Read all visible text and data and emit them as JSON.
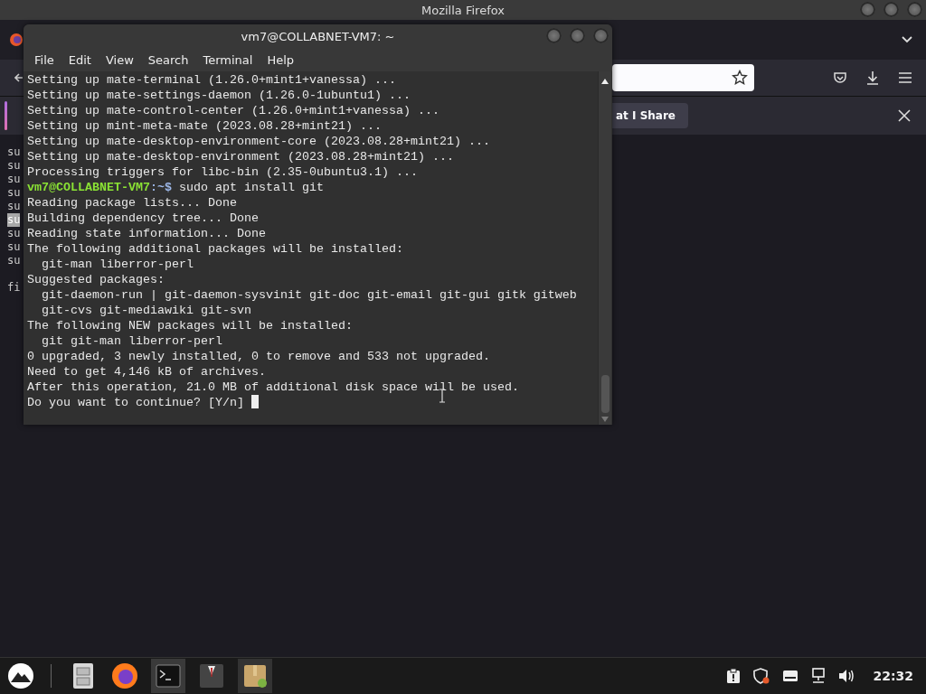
{
  "firefox": {
    "title": "Mozilla Firefox",
    "notification": "at I Share",
    "page_lines": [
      {
        "text": "su",
        "selected": false
      },
      {
        "text": "su",
        "selected": false
      },
      {
        "text": "su",
        "selected": false
      },
      {
        "text": "su",
        "selected": false
      },
      {
        "text": "su",
        "selected": false
      },
      {
        "text": "su",
        "selected": true
      },
      {
        "text": "su",
        "selected": false
      },
      {
        "text": "su",
        "selected": false
      },
      {
        "text": "su",
        "selected": false
      }
    ],
    "page_footer": {
      "text": "fi",
      "selected": false
    }
  },
  "terminal": {
    "title": "vm7@COLLABNET-VM7: ~",
    "menu": [
      "File",
      "Edit",
      "View",
      "Search",
      "Terminal",
      "Help"
    ],
    "lines": [
      {
        "kind": "output",
        "text": "Setting up mate-terminal (1.26.0+mint1+vanessa) ..."
      },
      {
        "kind": "output",
        "text": "Setting up mate-settings-daemon (1.26.0-1ubuntu1) ..."
      },
      {
        "kind": "output",
        "text": "Setting up mate-control-center (1.26.0+mint1+vanessa) ..."
      },
      {
        "kind": "output",
        "text": "Setting up mint-meta-mate (2023.08.28+mint21) ..."
      },
      {
        "kind": "output",
        "text": "Setting up mate-desktop-environment-core (2023.08.28+mint21) ..."
      },
      {
        "kind": "output",
        "text": "Setting up mate-desktop-environment (2023.08.28+mint21) ..."
      },
      {
        "kind": "output",
        "text": "Processing triggers for libc-bin (2.35-0ubuntu3.1) ..."
      },
      {
        "kind": "prompt",
        "user": "vm7@COLLABNET-VM7",
        "path": ":~$",
        "text": " sudo apt install git"
      },
      {
        "kind": "output",
        "text": "Reading package lists... Done"
      },
      {
        "kind": "output",
        "text": "Building dependency tree... Done"
      },
      {
        "kind": "output",
        "text": "Reading state information... Done"
      },
      {
        "kind": "output",
        "text": "The following additional packages will be installed:"
      },
      {
        "kind": "output",
        "text": "  git-man liberror-perl"
      },
      {
        "kind": "output",
        "text": "Suggested packages:"
      },
      {
        "kind": "output",
        "text": "  git-daemon-run | git-daemon-sysvinit git-doc git-email git-gui gitk gitweb"
      },
      {
        "kind": "output",
        "text": "  git-cvs git-mediawiki git-svn"
      },
      {
        "kind": "output",
        "text": "The following NEW packages will be installed:"
      },
      {
        "kind": "output",
        "text": "  git git-man liberror-perl"
      },
      {
        "kind": "output",
        "text": "0 upgraded, 3 newly installed, 0 to remove and 533 not upgraded."
      },
      {
        "kind": "output",
        "text": "Need to get 4,146 kB of archives."
      },
      {
        "kind": "output",
        "text": "After this operation, 21.0 MB of additional disk space will be used."
      },
      {
        "kind": "input",
        "text": "Do you want to continue? [Y/n] "
      }
    ]
  },
  "taskbar": {
    "clock": "22:32"
  }
}
